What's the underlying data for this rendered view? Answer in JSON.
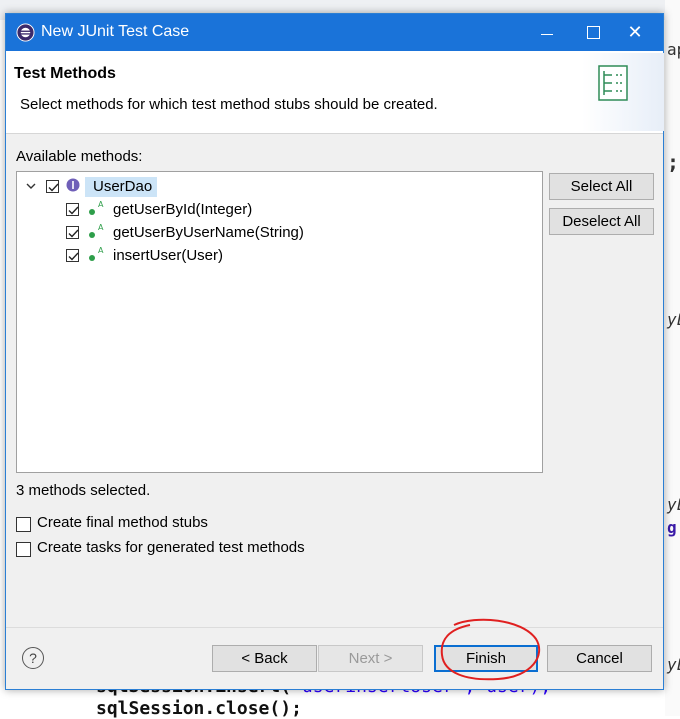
{
  "window": {
    "title": "New JUnit Test Case",
    "minimize_icon": "minimize-icon",
    "close_glyph": "✕"
  },
  "header": {
    "title": "Test Methods",
    "description": "Select methods for which test method stubs should be created."
  },
  "methods": {
    "label": "Available methods:",
    "tree": {
      "root": {
        "label": "UserDao",
        "checked": true,
        "expanded": true
      },
      "children": [
        {
          "label": "getUserById(Integer)",
          "checked": true
        },
        {
          "label": "getUserByUserName(String)",
          "checked": true
        },
        {
          "label": "insertUser(User)",
          "checked": true
        }
      ]
    },
    "select_all": "Select All",
    "deselect_all": "Deselect All",
    "count_text": "3 methods selected."
  },
  "options": {
    "final_stubs": {
      "label": "Create final method stubs",
      "checked": false
    },
    "tasks": {
      "label": "Create tasks for generated test methods",
      "checked": false
    }
  },
  "footer": {
    "help": "?",
    "back": "< Back",
    "next": "Next >",
    "finish": "Finish",
    "cancel": "Cancel"
  },
  "background": {
    "code_line_1_kw": "sqlSession.insert(",
    "code_line_1_str": "\"userinsertUser\", user);",
    "code_line_2": "sqlSession.close();",
    "side_chars": [
      "e",
      "ap",
      ";",
      "yL",
      "yL",
      "g",
      "yL"
    ]
  },
  "colors": {
    "titlebar": "#1a73d9",
    "selection": "#cce4f7",
    "annotation": "#e02020"
  }
}
